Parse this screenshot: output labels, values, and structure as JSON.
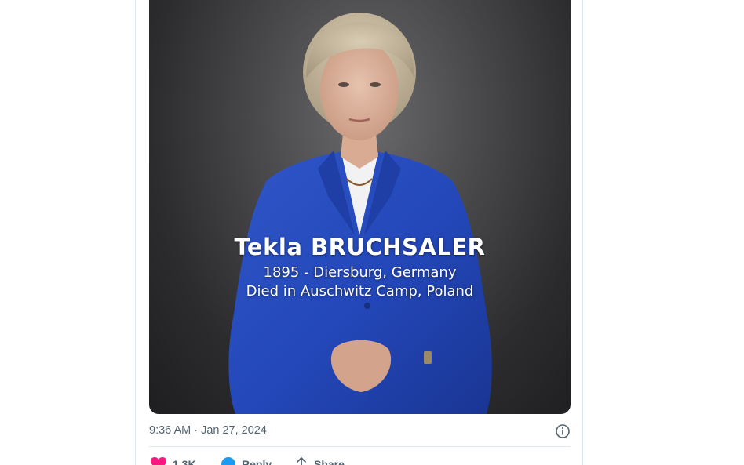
{
  "video": {
    "overlay_name": "Tekla BRUCHSALER",
    "overlay_line1": "1895 - Diersburg, Germany",
    "overlay_line2": "Died in Auschwitz Camp, Poland"
  },
  "meta": {
    "timestamp": "9:36 AM · Jan 27, 2024",
    "info_icon": "info-icon"
  },
  "actions": {
    "like_count": "1.3K",
    "reply_label": "Reply",
    "share_label": "Share"
  },
  "colors": {
    "like": "#f91880",
    "reply": "#1d9bf0",
    "meta_text": "#536471",
    "jacket": "#2347b8"
  }
}
